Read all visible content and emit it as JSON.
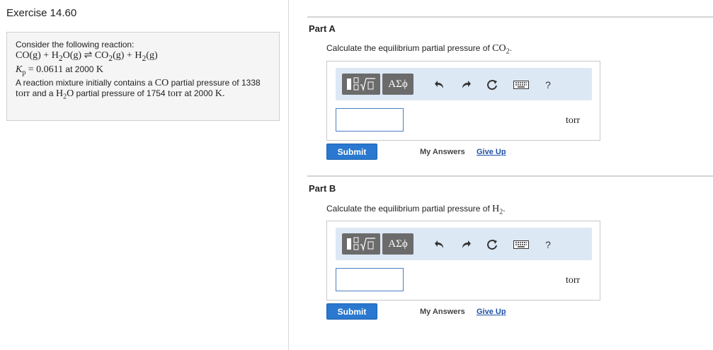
{
  "exercise": {
    "title": "Exercise 14.60"
  },
  "problem": {
    "intro": "Consider the following reaction:",
    "equation": {
      "lhs1": "CO(g)",
      "plus1": "+",
      "lhs2_pre": "H",
      "lhs2_sub": "2",
      "lhs2_post": "O(g)",
      "arrow": "⇌",
      "rhs1_pre": "CO",
      "rhs1_sub": "2",
      "rhs1_post": "(g)",
      "plus2": "+",
      "rhs2_pre": "H",
      "rhs2_sub": "2",
      "rhs2_post": "(g)"
    },
    "kp": {
      "symbol": "K",
      "sub": "p",
      "equals": "= 0.0611",
      "temp_text": "at 2000",
      "temp_unit": "K"
    },
    "body": {
      "t1": "A reaction mixture initially contains a",
      "co": "CO",
      "t2": "partial pressure of",
      "v1": "1338",
      "u1": "torr",
      "t3": "and a",
      "h": "H",
      "h_sub": "2",
      "o": "O",
      "t4": "partial pressure of 1754",
      "u2": "torr",
      "t5": "at 2000",
      "k": "K."
    }
  },
  "parts": [
    {
      "title": "Part A",
      "question_pre": "Calculate the equilibrium partial pressure of",
      "species": "CO",
      "species_sub": "2",
      "question_post": ".",
      "input_value": "",
      "unit": "torr",
      "submit_label": "Submit",
      "my_answers_label": "My Answers",
      "give_up_label": "Give Up"
    },
    {
      "title": "Part B",
      "question_pre": "Calculate the equilibrium partial pressure of",
      "species": "H",
      "species_sub": "2",
      "question_post": ".",
      "input_value": "",
      "unit": "torr",
      "submit_label": "Submit",
      "my_answers_label": "My Answers",
      "give_up_label": "Give Up"
    }
  ],
  "toolbar": {
    "greek_label": "ΑΣϕ",
    "help_label": "?",
    "icons": [
      "templates-icon",
      "greek-symbols",
      "undo-icon",
      "redo-icon",
      "reset-icon",
      "keyboard-icon",
      "help-icon"
    ]
  },
  "colors": {
    "toolbar_bg": "#dde8f5",
    "submit_bg": "#2a78cf",
    "link_blue": "#1f4fa5",
    "button_gray": "#6b6b6b"
  }
}
